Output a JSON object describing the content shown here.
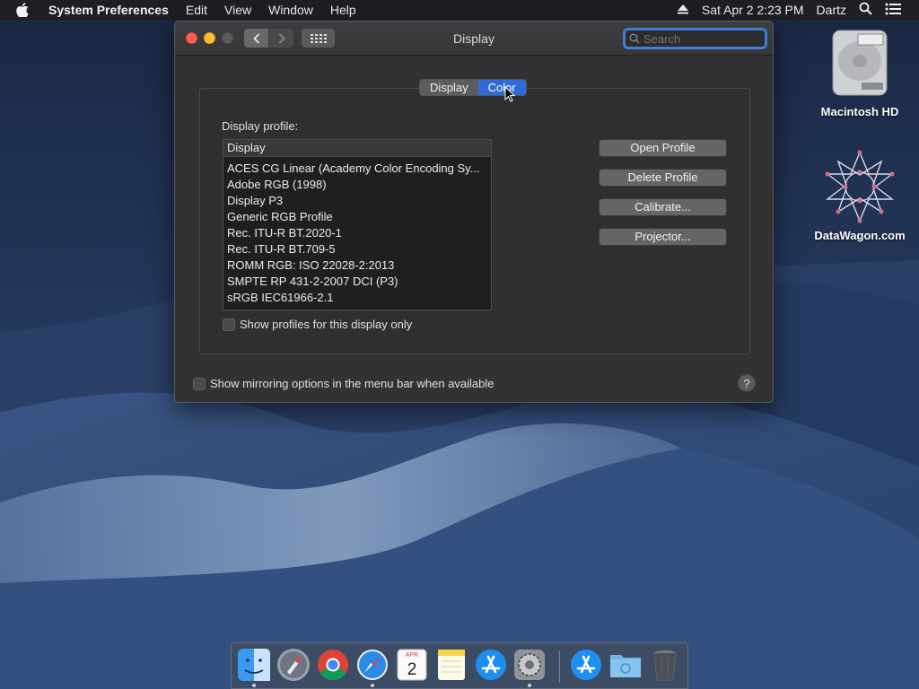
{
  "menubar": {
    "app_name": "System Preferences",
    "items": [
      "Edit",
      "View",
      "Window",
      "Help"
    ],
    "datetime": "Sat Apr 2  2:23 PM",
    "user": "Dartz"
  },
  "window": {
    "title": "Display",
    "search_placeholder": "Search",
    "tabs": [
      {
        "label": "Display",
        "active": false
      },
      {
        "label": "Color",
        "active": true
      }
    ],
    "profile_label": "Display profile:",
    "list_header": "Display",
    "profiles": [
      "ACES CG Linear (Academy Color Encoding Sy...",
      "Adobe RGB (1998)",
      "Display P3",
      "Generic RGB Profile",
      "Rec. ITU-R BT.2020-1",
      "Rec. ITU-R BT.709-5",
      "ROMM RGB: ISO 22028-2:2013",
      "SMPTE RP 431-2-2007 DCI (P3)",
      "sRGB IEC61966-2.1"
    ],
    "show_profiles_label": "Show profiles for this display only",
    "buttons": {
      "open": "Open Profile",
      "delete": "Delete Profile",
      "calibrate": "Calibrate...",
      "projector": "Projector..."
    },
    "mirroring_label": "Show mirroring options in the menu bar when available",
    "help": "?"
  },
  "desktop": {
    "icons": [
      {
        "label": "Macintosh HD"
      },
      {
        "label": "DataWagon.com"
      }
    ]
  },
  "dock": {
    "calendar_month": "APR",
    "calendar_day": "2"
  },
  "colors": {
    "accent": "#2f6bd9",
    "window_bg": "#323234",
    "close": "#fd5f57",
    "minimize": "#febc2e"
  }
}
